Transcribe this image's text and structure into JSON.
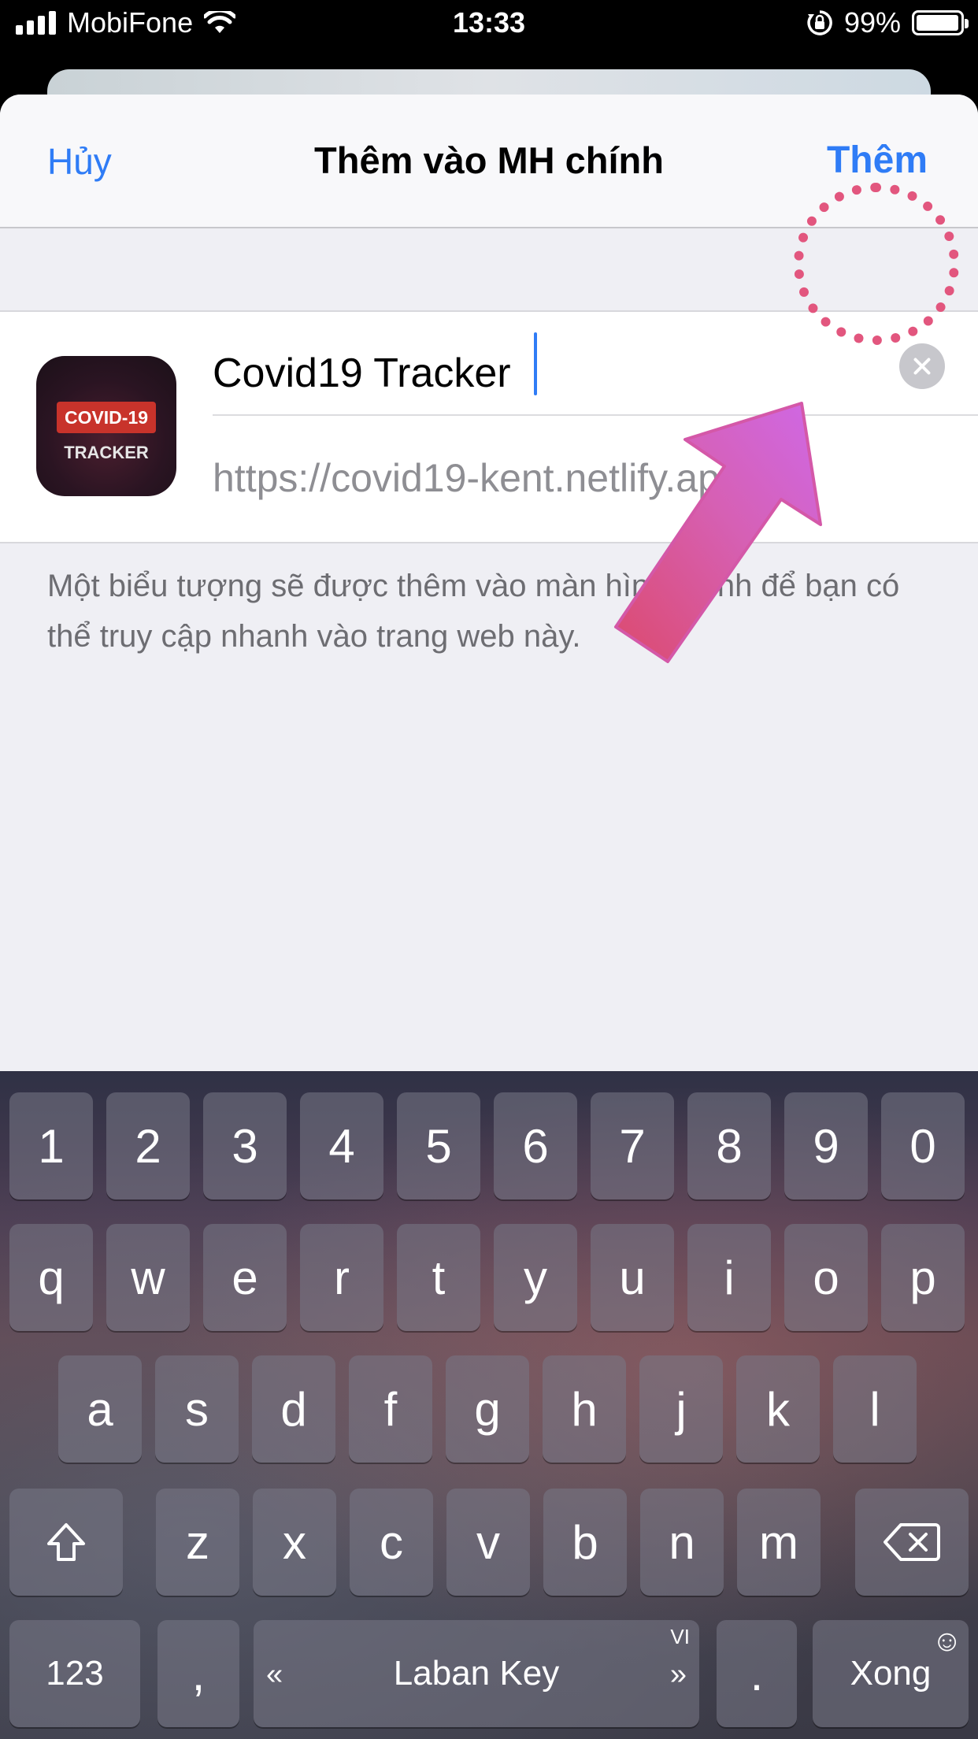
{
  "status": {
    "carrier": "MobiFone",
    "time": "13:33",
    "battery": "99%",
    "battery_level": 0.99
  },
  "nav": {
    "cancel": "Hủy",
    "title": "Thêm vào MH chính",
    "add": "Thêm"
  },
  "app": {
    "icon_badge": "COVID-19",
    "icon_sub": "TRACKER",
    "name": "Covid19 Tracker",
    "url": "https://covid19-kent.netlify.app/"
  },
  "description": "Một biểu tượng sẽ được thêm vào màn hình chính để bạn có thể truy cập nhanh vào trang web này.",
  "keyboard": {
    "row1": [
      "1",
      "2",
      "3",
      "4",
      "5",
      "6",
      "7",
      "8",
      "9",
      "0"
    ],
    "row2": [
      "q",
      "w",
      "e",
      "r",
      "t",
      "y",
      "u",
      "i",
      "o",
      "p"
    ],
    "row3": [
      "a",
      "s",
      "d",
      "f",
      "g",
      "h",
      "j",
      "k",
      "l"
    ],
    "row4": [
      "z",
      "x",
      "c",
      "v",
      "b",
      "n",
      "m"
    ],
    "numbers_key": "123",
    "comma_key": ",",
    "space_label": "Laban Key",
    "lang_tag": "VI",
    "period_key": ".",
    "done_key": "Xong",
    "shift_icon": "shift-icon",
    "delete_icon": "backspace-icon",
    "emoji_icon": "emoji-icon"
  },
  "colors": {
    "accent": "#2f7cf6",
    "annotation": "#e2567e"
  }
}
